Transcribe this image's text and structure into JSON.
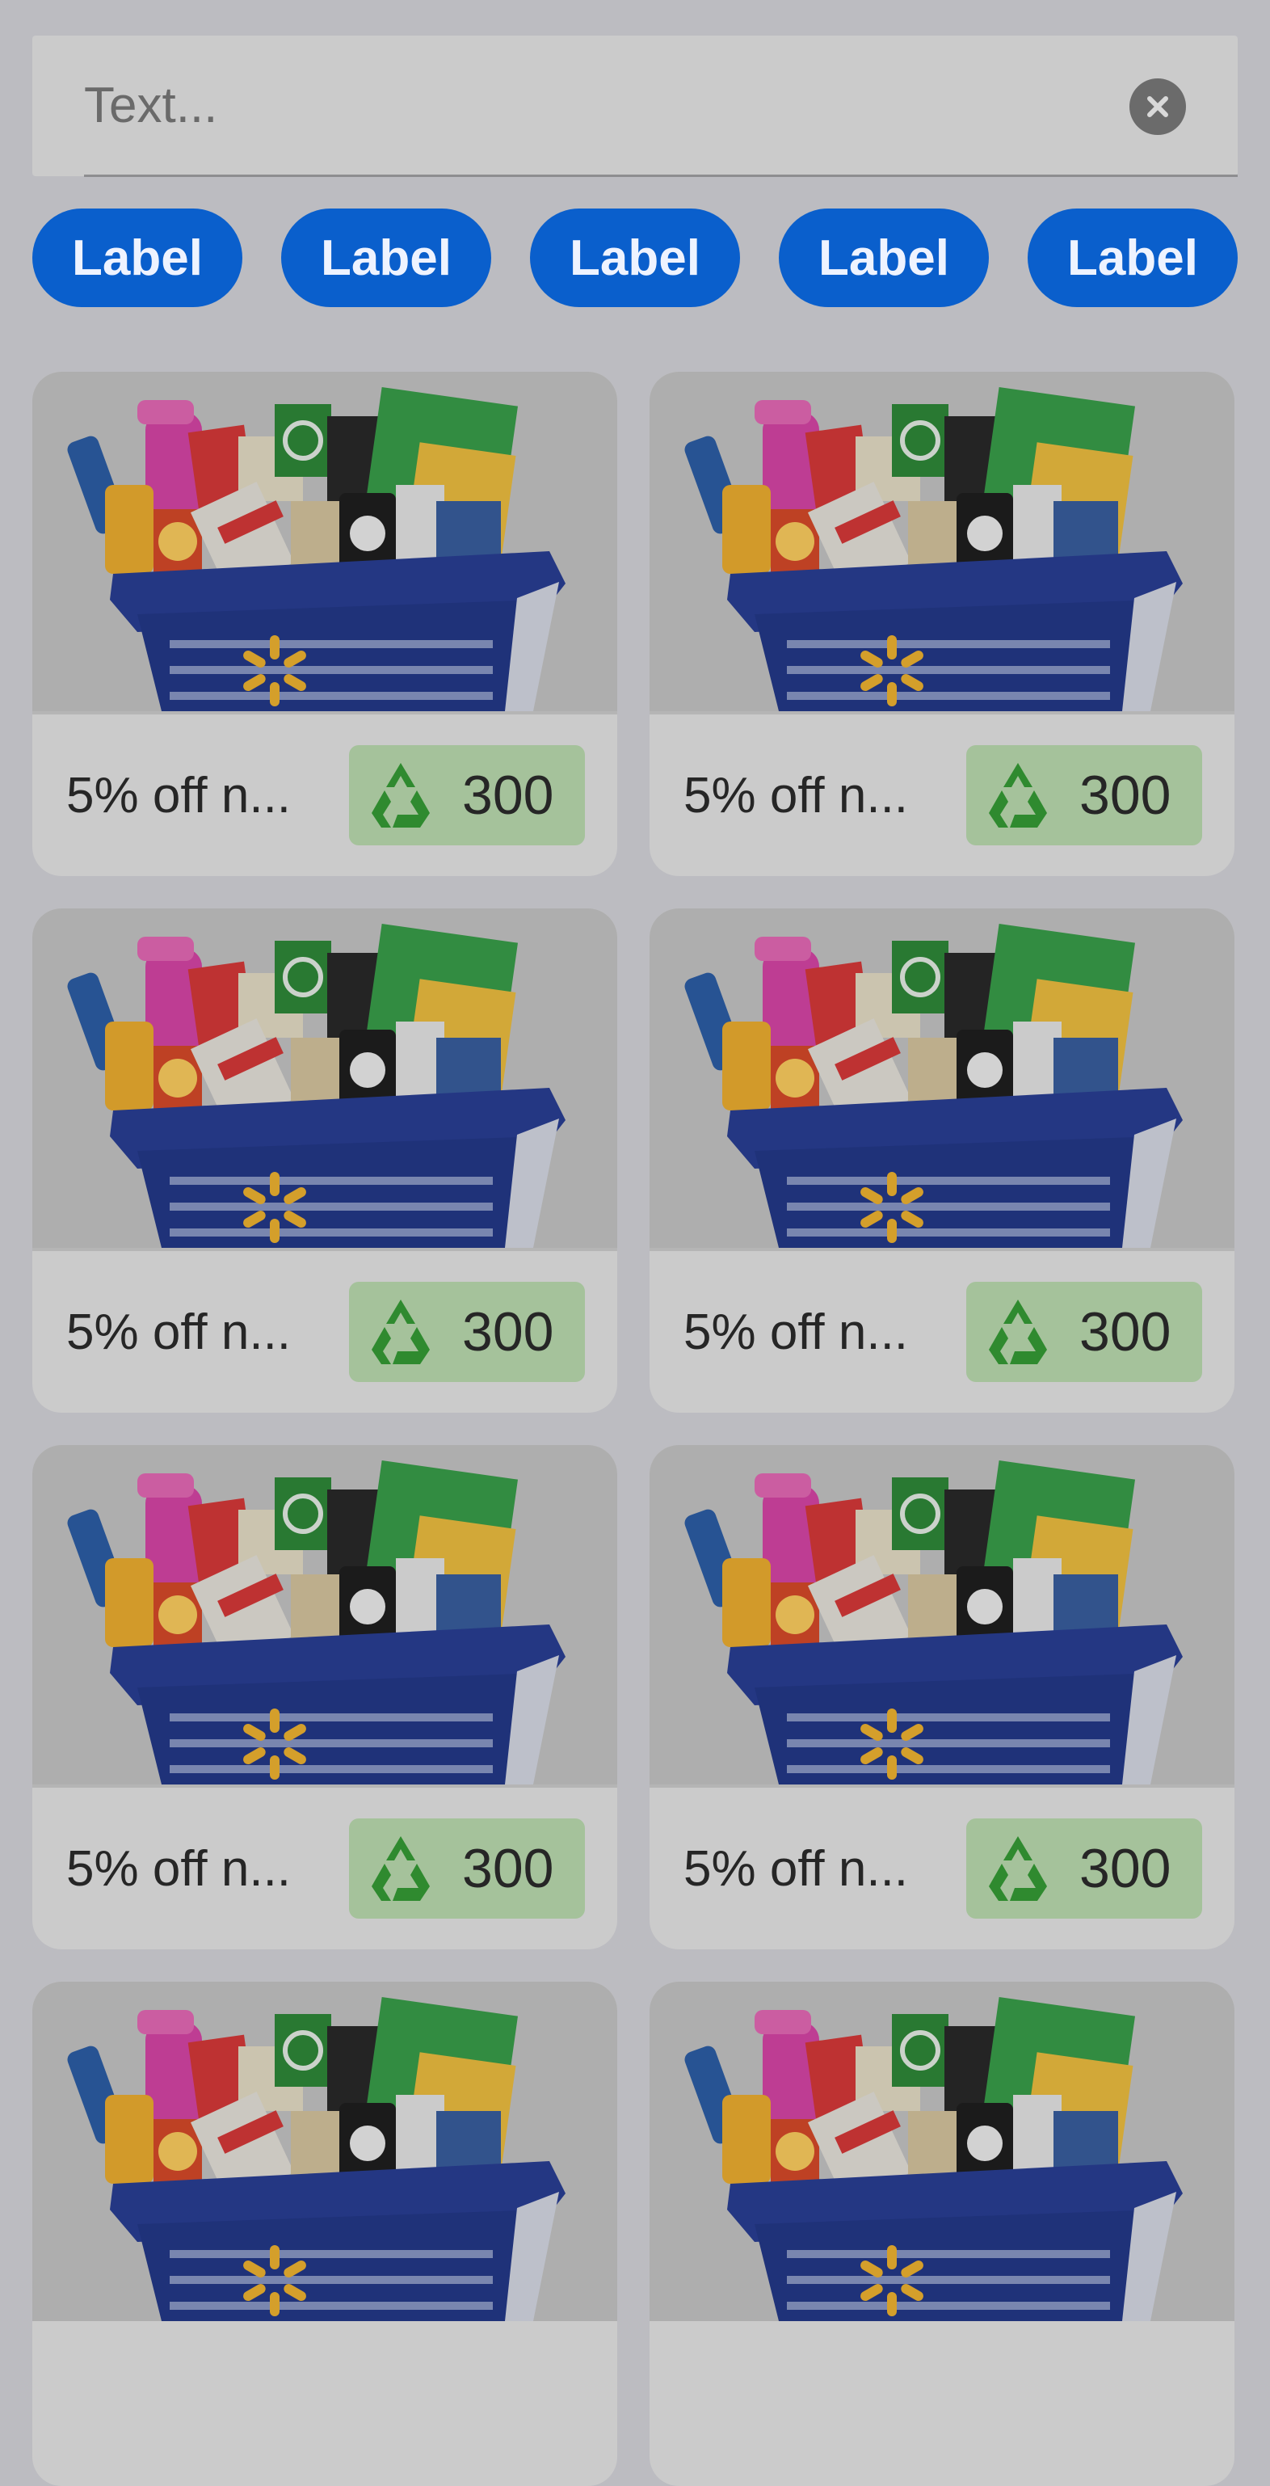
{
  "search": {
    "placeholder": "Text...",
    "clear_icon": "close-circle-icon"
  },
  "chips": [
    "Label",
    "Label",
    "Label",
    "Label",
    "Label"
  ],
  "colors": {
    "chip": "#0a5fcc",
    "badge": "#a5c29b",
    "recycle": "#2f8a2f",
    "background": "#bcbcc1"
  },
  "cards": [
    {
      "title": "5% off n...",
      "points": "300",
      "image": "grocery-basket-image",
      "points_icon": "recycle-icon"
    },
    {
      "title": "5% off n...",
      "points": "300",
      "image": "grocery-basket-image",
      "points_icon": "recycle-icon"
    },
    {
      "title": "5% off n...",
      "points": "300",
      "image": "grocery-basket-image",
      "points_icon": "recycle-icon"
    },
    {
      "title": "5% off n...",
      "points": "300",
      "image": "grocery-basket-image",
      "points_icon": "recycle-icon"
    },
    {
      "title": "5% off n...",
      "points": "300",
      "image": "grocery-basket-image",
      "points_icon": "recycle-icon"
    },
    {
      "title": "5% off n...",
      "points": "300",
      "image": "grocery-basket-image",
      "points_icon": "recycle-icon"
    },
    {
      "title": "",
      "points": "",
      "image": "grocery-basket-image",
      "points_icon": "recycle-icon"
    },
    {
      "title": "",
      "points": "",
      "image": "grocery-basket-image",
      "points_icon": "recycle-icon"
    }
  ]
}
